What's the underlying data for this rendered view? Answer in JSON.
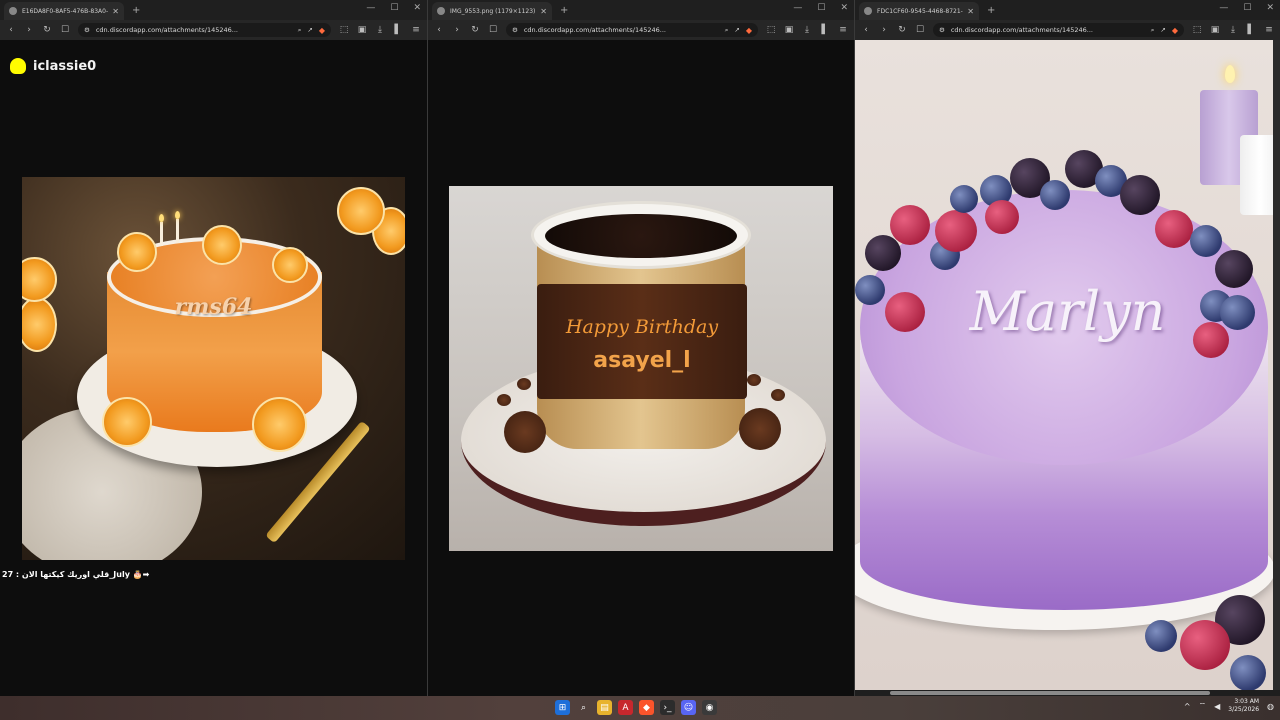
{
  "windows": [
    {
      "tab_title": "E16DA8F0-8AF5-476B-83A0-25F",
      "url": "cdn.discordapp.com/attachments/145246...",
      "snap_username": "iclassie0",
      "caption": "قلي اوريك كيكتها الان : 27_July 🎂➡",
      "cake_text": "rms64"
    },
    {
      "tab_title": "IMG_9553.png (1179×1123)",
      "url": "cdn.discordapp.com/attachments/145246...",
      "band_line1": "Happy Birthday",
      "band_line2": "asayel_l"
    },
    {
      "tab_title": "FDC1CF60-9545-4468-8721-8C8",
      "url": "cdn.discordapp.com/attachments/145246...",
      "cake_text": "Marlyn"
    }
  ],
  "common": {
    "new_tab": "+",
    "close": "✕",
    "minimize": "—",
    "maximize": "☐"
  },
  "taskbar": {
    "time": "3:03 AM",
    "date": "3/25/2026",
    "apps": [
      "start-icon",
      "search-icon",
      "file-explorer-icon",
      "acrobat-icon",
      "brave-icon",
      "terminal-icon",
      "discord-icon",
      "chrome-icon"
    ]
  },
  "colors": {
    "snap_yellow": "#fffc00",
    "brave_orange": "#ff6a3d",
    "cup_text": "#f29a38"
  }
}
